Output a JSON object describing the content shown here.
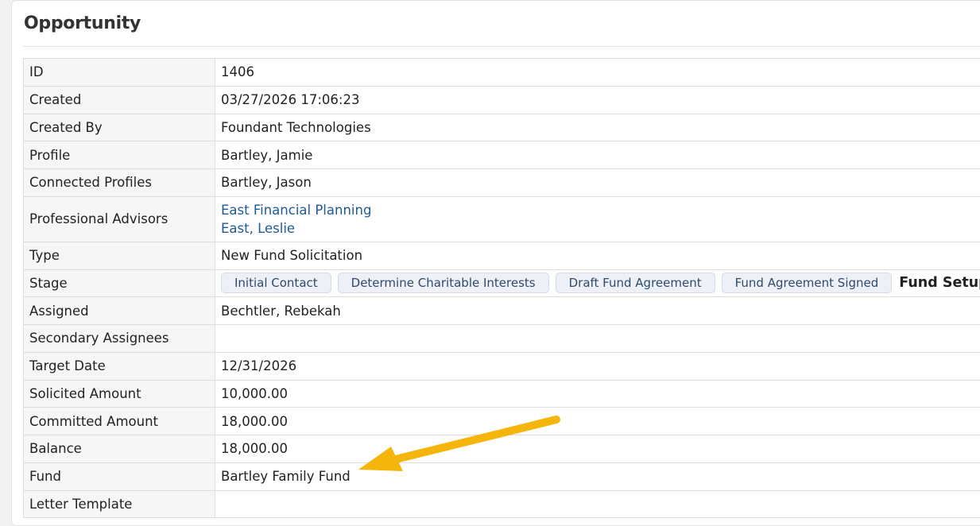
{
  "panel": {
    "title": "Opportunity"
  },
  "fields": {
    "id": {
      "label": "ID",
      "value": "1406"
    },
    "created": {
      "label": "Created",
      "value": "03/27/2026 17:06:23"
    },
    "created_by": {
      "label": "Created By",
      "value": "Foundant Technologies"
    },
    "profile": {
      "label": "Profile",
      "value": "Bartley, Jamie"
    },
    "connected_profiles": {
      "label": "Connected Profiles",
      "value": "Bartley, Jason"
    },
    "professional_advisors": {
      "label": "Professional Advisors",
      "values": [
        "East Financial Planning",
        "East, Leslie"
      ]
    },
    "type": {
      "label": "Type",
      "value": "New Fund Solicitation"
    },
    "stage": {
      "label": "Stage",
      "steps": [
        "Initial Contact",
        "Determine Charitable Interests",
        "Draft Fund Agreement",
        "Fund Agreement Signed"
      ],
      "current": "Fund Setup"
    },
    "assigned": {
      "label": "Assigned",
      "value": "Bechtler, Rebekah"
    },
    "secondary_assignees": {
      "label": "Secondary Assignees",
      "value": ""
    },
    "target_date": {
      "label": "Target Date",
      "value": "12/31/2026"
    },
    "solicited_amount": {
      "label": "Solicited Amount",
      "value": "10,000.00"
    },
    "committed_amount": {
      "label": "Committed Amount",
      "value": "18,000.00"
    },
    "balance": {
      "label": "Balance",
      "value": "18,000.00"
    },
    "fund": {
      "label": "Fund",
      "value": "Bartley Family Fund"
    },
    "letter_template": {
      "label": "Letter Template",
      "value": ""
    }
  },
  "annotation": {
    "type": "arrow-callout",
    "color": "#f5b50a",
    "points_to": "fund"
  }
}
